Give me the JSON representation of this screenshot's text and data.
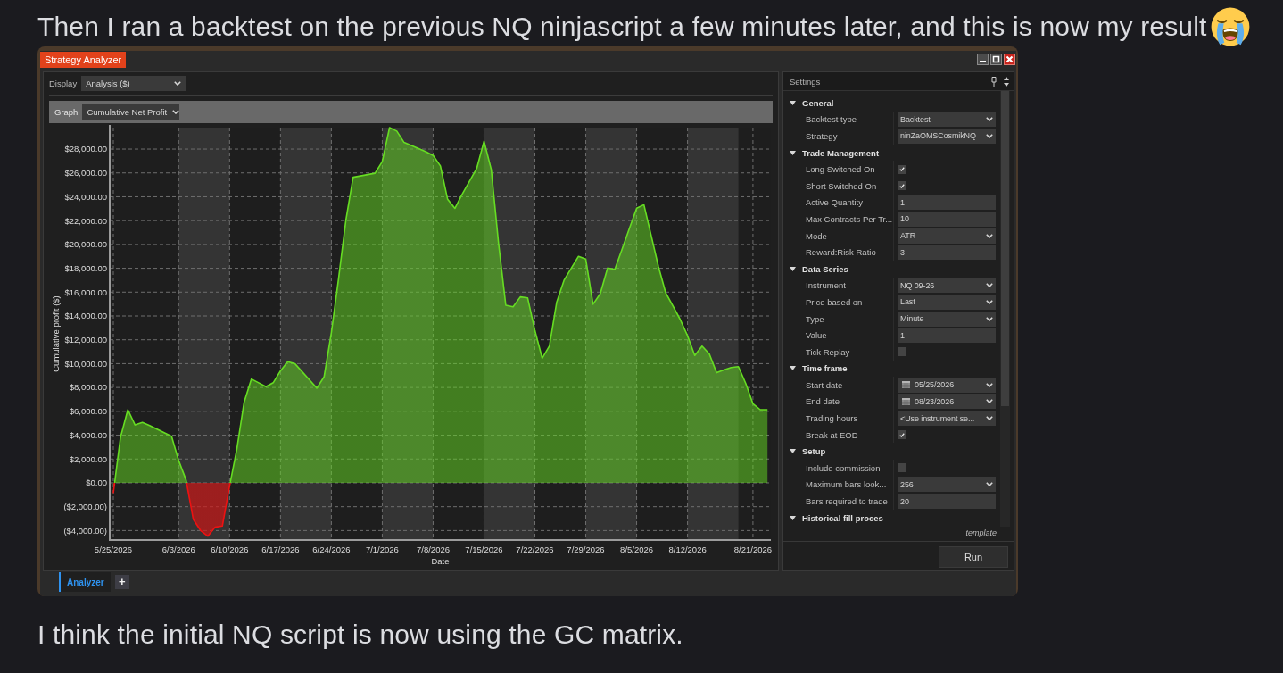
{
  "message_top": "Then I ran a backtest on the previous NQ ninjascript a few minutes later, and this is now my result",
  "screenshot": {
    "window": {
      "title": "Strategy Analyzer"
    },
    "display": {
      "label": "Display",
      "value": "Analysis ($)"
    },
    "graph": {
      "label": "Graph",
      "value": "Cumulative Net Profit",
      "chart_data": {
        "type": "area",
        "grid": true,
        "xlabel": "Date",
        "ylabel": "Cumulative profit ($)",
        "categories": [
          "5/25/2026",
          null,
          null,
          null,
          null,
          null,
          null,
          null,
          null,
          "6/3/2026",
          null,
          null,
          null,
          null,
          null,
          null,
          "6/10/2026",
          null,
          null,
          null,
          null,
          null,
          null,
          "6/17/2026",
          null,
          null,
          null,
          null,
          null,
          null,
          "6/24/2026",
          null,
          null,
          null,
          null,
          null,
          null,
          "7/1/2026",
          null,
          null,
          null,
          null,
          null,
          null,
          "7/8/2026",
          null,
          null,
          null,
          null,
          null,
          null,
          "7/15/2026",
          null,
          null,
          null,
          null,
          null,
          null,
          "7/22/2026",
          null,
          null,
          null,
          null,
          null,
          null,
          "7/29/2026",
          null,
          null,
          null,
          null,
          null,
          null,
          "8/5/2026",
          null,
          null,
          null,
          null,
          null,
          null,
          "8/12/2026",
          null,
          null,
          null,
          null,
          null,
          null,
          null,
          null,
          "8/21/2026",
          null,
          null
        ],
        "series": [
          {
            "color": "#66dd22",
            "values": [
              -850,
              3840,
              6140,
              4860,
              5070,
              4810,
              4510,
              4210,
              3920,
              1860,
              250,
              -3050,
              -3990,
              -4470,
              -3720,
              -3620,
              -270,
              2850,
              6760,
              8710,
              8390,
              8070,
              8400,
              9400,
              10160,
              9990,
              9310,
              8620,
              7940,
              8910,
              12610,
              17160,
              22050,
              25640,
              25750,
              25860,
              25970,
              26950,
              29800,
              29510,
              28560,
              28300,
              28040,
              27780,
              27460,
              26590,
              23790,
              23030,
              24210,
              25290,
              26380,
              28660,
              26290,
              20080,
              14900,
              14770,
              15600,
              15510,
              12780,
              10460,
              11480,
              15140,
              16980,
              18000,
              19000,
              18770,
              14980,
              15870,
              18030,
              17910,
              19620,
              21340,
              23040,
              23330,
              20730,
              18130,
              15950,
              14830,
              13700,
              12340,
              10690,
              11470,
              10820,
              9240,
              9470,
              9680,
              9750,
              8350,
              6640,
              6140,
              6140
            ]
          }
        ],
        "ylim": [
          -4720,
          29800
        ],
        "yticks": [
          {
            "value": -4000,
            "label": "($4,000.00)"
          },
          {
            "value": -2000,
            "label": "($2,000.00)"
          },
          {
            "value": 0,
            "label": "$0.00"
          },
          {
            "value": 2000,
            "label": "$2,000.00"
          },
          {
            "value": 4000,
            "label": "$4,000.00"
          },
          {
            "value": 6000,
            "label": "$6,000.00"
          },
          {
            "value": 8000,
            "label": "$8,000.00"
          },
          {
            "value": 10000,
            "label": "$10,000.00"
          },
          {
            "value": 12000,
            "label": "$12,000.00"
          },
          {
            "value": 14000,
            "label": "$14,000.00"
          },
          {
            "value": 16000,
            "label": "$16,000.00"
          },
          {
            "value": 18000,
            "label": "$18,000.00"
          },
          {
            "value": 20000,
            "label": "$20,000.00"
          },
          {
            "value": 22000,
            "label": "$22,000.00"
          },
          {
            "value": 24000,
            "label": "$24,000.00"
          },
          {
            "value": 26000,
            "label": "$26,000.00"
          },
          {
            "value": 28000,
            "label": "$28,000.00"
          }
        ]
      }
    },
    "settings": {
      "title": "Settings",
      "categories": [
        {
          "label": "General",
          "expanded": true,
          "properties": [
            {
              "label": "Backtest type",
              "kind": "dropdown",
              "value": "Backtest"
            },
            {
              "label": "Strategy",
              "kind": "dropdown",
              "value": "ninZaOMSCosmikNQ"
            }
          ]
        },
        {
          "label": "Trade Management",
          "expanded": true,
          "properties": [
            {
              "label": "Long Switched On",
              "kind": "checkbox",
              "checked": true
            },
            {
              "label": "Short Switched On",
              "kind": "checkbox",
              "checked": true
            },
            {
              "label": "Active Quantity",
              "kind": "text",
              "value": "1"
            },
            {
              "label": "Max Contracts Per Tr...",
              "kind": "text",
              "value": "10"
            },
            {
              "label": "Mode",
              "kind": "dropdown",
              "value": "ATR"
            },
            {
              "label": "Reward:Risk Ratio",
              "kind": "text",
              "value": "3"
            }
          ]
        },
        {
          "label": "Data Series",
          "expanded": true,
          "properties": [
            {
              "label": "Instrument",
              "kind": "dropdown",
              "value": "NQ 09-26"
            },
            {
              "label": "Price based on",
              "kind": "dropdown",
              "value": "Last"
            },
            {
              "label": "Type",
              "kind": "dropdown",
              "value": "Minute"
            },
            {
              "label": "Value",
              "kind": "text",
              "value": "1"
            },
            {
              "label": "Tick Replay",
              "kind": "checkbox",
              "checked": false
            }
          ]
        },
        {
          "label": "Time frame",
          "expanded": true,
          "properties": [
            {
              "label": "Start date",
              "kind": "date",
              "value": "05/25/2026"
            },
            {
              "label": "End date",
              "kind": "date",
              "value": "08/23/2026"
            },
            {
              "label": "Trading hours",
              "kind": "dropdown",
              "value": "<Use instrument se..."
            },
            {
              "label": "Break at EOD",
              "kind": "checkbox",
              "checked": true
            }
          ]
        },
        {
          "label": "Setup",
          "expanded": true,
          "properties": [
            {
              "label": "Include commission",
              "kind": "checkbox",
              "checked": false
            },
            {
              "label": "Maximum bars look...",
              "kind": "dropdown",
              "value": "256"
            },
            {
              "label": "Bars required to trade",
              "kind": "text",
              "value": "20"
            }
          ]
        },
        {
          "label": "Historical fill proces",
          "expanded": true
        }
      ],
      "template_link": "template",
      "run_button": "Run"
    },
    "tabs": [
      {
        "label": "Analyzer",
        "selected": true
      }
    ],
    "add_tab_button": "+"
  },
  "message_bottom": "I think the initial NQ script is now using the GC matrix."
}
